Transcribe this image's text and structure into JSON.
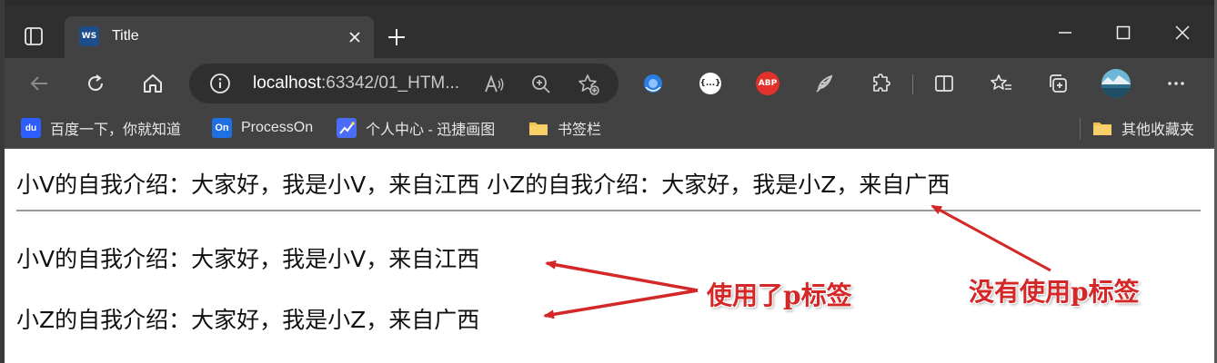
{
  "browser": {
    "tab": {
      "title": "Title",
      "favicon_text": "WS",
      "favicon_icon": "webstorm-icon"
    },
    "new_tab_label": "+",
    "address": {
      "host": "localhost",
      "rest": ":63342/01_HTM..."
    },
    "bookmarks": [
      {
        "label": "百度一下，你就知道",
        "icon": "baidu-icon",
        "icon_text": "du",
        "icon_color": "#2e5eff"
      },
      {
        "label": "ProcessOn",
        "icon": "processon-icon",
        "icon_text": "On",
        "icon_color": "#1f6fe5"
      },
      {
        "label": "个人中心 - 迅捷画图",
        "icon": "xunjie-icon",
        "icon_text": "",
        "icon_color": "#4a6cf7"
      },
      {
        "label": "书签栏",
        "icon": "folder-icon",
        "icon_text": "",
        "icon_color": "#f2c14e"
      }
    ],
    "other_bookmarks": {
      "label": "其他收藏夹",
      "icon": "folder-icon"
    },
    "extensions": [
      {
        "name": "extension-blue-icon",
        "text": ""
      },
      {
        "name": "extension-code-icon",
        "text": "{...}"
      },
      {
        "name": "adblock-icon",
        "text": "ABP"
      },
      {
        "name": "extension-feather-icon",
        "text": ""
      }
    ]
  },
  "page": {
    "line1": "小V的自我介绍：大家好，我是小V，来自江西 小Z的自我介绍：大家好，我是小Z，来自广西",
    "p1": "小V的自我介绍：大家好，我是小V，来自江西",
    "p2": "小Z的自我介绍：大家好，我是小Z，来自广西",
    "annotation_used": "使用了p标签",
    "annotation_not_used": "没有使用p标签",
    "annotation_color": "#d42828"
  },
  "colors": {
    "tabbar": "#2f2f2f",
    "toolbar": "#424242",
    "arrow": "#d42828"
  }
}
